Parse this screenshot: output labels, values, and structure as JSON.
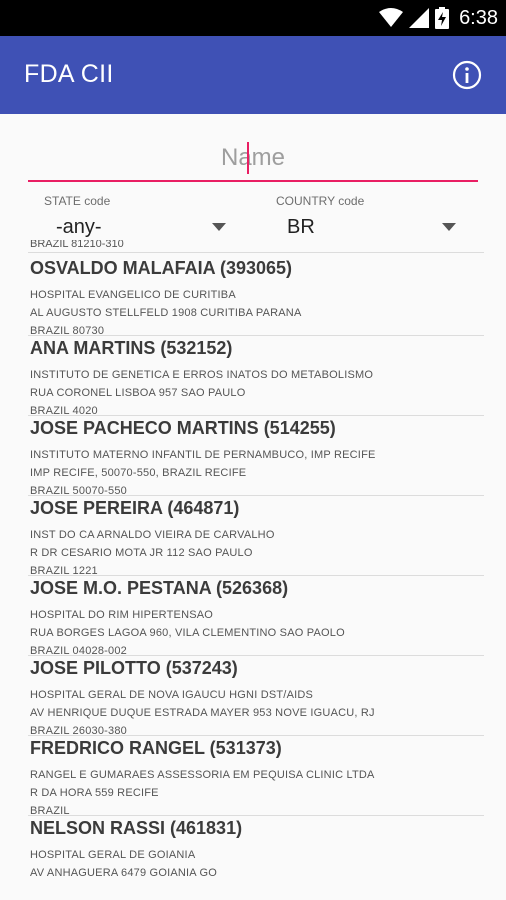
{
  "status": {
    "time": "6:38"
  },
  "app": {
    "title": "FDA CII"
  },
  "search": {
    "placeholder": "Name",
    "value": ""
  },
  "filters": {
    "state": {
      "label": "STATE code",
      "value": "-any-"
    },
    "country": {
      "label": "COUNTRY code",
      "value": "BR"
    }
  },
  "partial_top_line": "BRAZIL 81210-310",
  "list": [
    {
      "name": "OSVALDO MALAFAIA (393065)",
      "lines": [
        "HOSPITAL EVANGELICO DE CURITIBA",
        "AL AUGUSTO STELLFELD 1908 CURITIBA PARANA",
        "BRAZIL 80730"
      ]
    },
    {
      "name": "ANA MARTINS (532152)",
      "lines": [
        "INSTITUTO DE GENETICA E ERROS INATOS DO METABOLISMO",
        "RUA CORONEL LISBOA 957 SAO PAULO",
        "BRAZIL 4020"
      ]
    },
    {
      "name": "JOSE PACHECO MARTINS (514255)",
      "lines": [
        "INSTITUTO MATERNO INFANTIL DE PERNAMBUCO, IMP RECIFE",
        "IMP RECIFE, 50070-550, BRAZIL RECIFE",
        "BRAZIL 50070-550"
      ]
    },
    {
      "name": "JOSE PEREIRA (464871)",
      "lines": [
        "INST DO CA ARNALDO VIEIRA DE CARVALHO",
        "R DR CESARIO MOTA JR 112 SAO PAULO",
        "BRAZIL 1221"
      ]
    },
    {
      "name": "JOSE M.O. PESTANA (526368)",
      "lines": [
        "HOSPITAL DO RIM HIPERTENSAO",
        "RUA BORGES LAGOA 960, VILA CLEMENTINO SAO PAOLO",
        "BRAZIL 04028-002"
      ]
    },
    {
      "name": "JOSE PILOTTO (537243)",
      "lines": [
        "HOSPITAL GERAL DE NOVA IGAUCU HGNI DST/AIDS",
        "AV HENRIQUE DUQUE ESTRADA MAYER 953 NOVE IGUACU, RJ",
        "BRAZIL 26030-380"
      ]
    },
    {
      "name": "FREDRICO RANGEL (531373)",
      "lines": [
        "RANGEL E GUMARAES ASSESSORIA EM PEQUISA CLINIC LTDA",
        "R DA HORA 559 RECIFE",
        "BRAZIL"
      ]
    },
    {
      "name": "NELSON RASSI (461831)",
      "lines": [
        "HOSPITAL GERAL DE GOIANIA",
        "AV ANHAGUERA 6479 GOIANIA GO",
        ""
      ]
    }
  ],
  "colors": {
    "appbar": "#3f51b5",
    "accent": "#e91e63",
    "statusbar": "#000000"
  },
  "icons": {
    "wifi": "wifi-icon",
    "signal": "cell-signal-icon",
    "battery": "battery-charging-icon",
    "info": "info-icon",
    "dropdown": "dropdown-arrow-icon"
  }
}
